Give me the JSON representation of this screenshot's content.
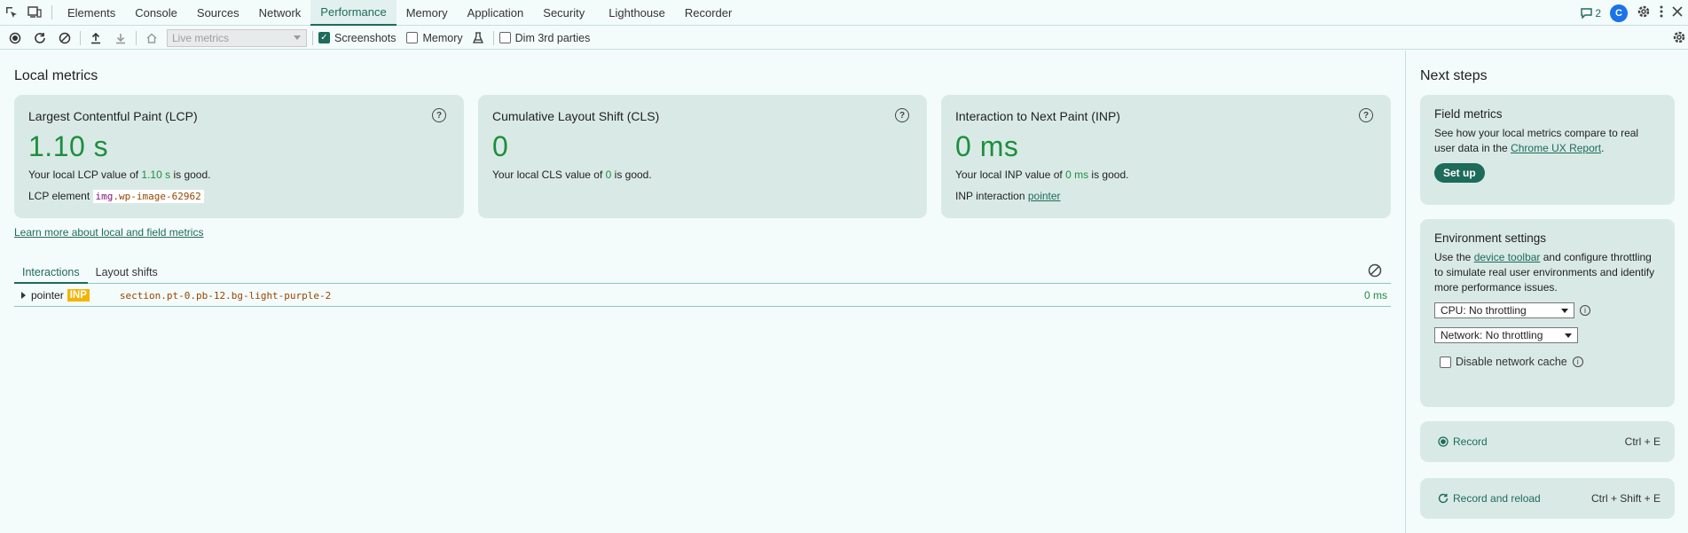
{
  "tabs": [
    "Elements",
    "Console",
    "Sources",
    "Network",
    "Performance",
    "Memory",
    "Application",
    "Security",
    "Lighthouse",
    "Recorder"
  ],
  "active_tab": "Performance",
  "issues_count": "2",
  "toolbar": {
    "select_value": "Live metrics",
    "screenshots_label": "Screenshots",
    "memory_label": "Memory",
    "dim_label": "Dim 3rd parties"
  },
  "local": {
    "title": "Local metrics",
    "lcp": {
      "title": "Largest Contentful Paint (LCP)",
      "value": "1.10 s",
      "desc_prefix": "Your local LCP value of ",
      "desc_value": "1.10 s",
      "desc_suffix": " is good.",
      "detail_label": "LCP element",
      "detail_tag": "img",
      "detail_class": ".wp-image-62962"
    },
    "cls": {
      "title": "Cumulative Layout Shift (CLS)",
      "value": "0",
      "desc_prefix": "Your local CLS value of ",
      "desc_value": "0",
      "desc_suffix": " is good."
    },
    "inp": {
      "title": "Interaction to Next Paint (INP)",
      "value": "0 ms",
      "desc_prefix": "Your local INP value of ",
      "desc_value": "0 ms",
      "desc_suffix": " is good.",
      "detail_label": "INP interaction",
      "detail_link": "pointer"
    },
    "learn_link": "Learn more about local and field metrics",
    "subtabs": [
      "Interactions",
      "Layout shifts"
    ],
    "row": {
      "type": "pointer",
      "badge": "INP",
      "selector": "section.pt-0.pb-12.bg-light-purple-2",
      "duration": "0 ms"
    }
  },
  "next": {
    "title": "Next steps",
    "field": {
      "title": "Field metrics",
      "text_prefix": "See how your local metrics compare to real user data in the ",
      "link": "Chrome UX Report",
      "text_suffix": ".",
      "button": "Set up"
    },
    "env": {
      "title": "Environment settings",
      "text_prefix": "Use the ",
      "link": "device toolbar",
      "text_suffix": " and configure throttling to simulate real user environments and identify more performance issues.",
      "cpu": "CPU: No throttling",
      "network": "Network: No throttling",
      "cache_label": "Disable network cache"
    },
    "record": {
      "label": "Record",
      "shortcut": "Ctrl + E"
    },
    "reload": {
      "label": "Record and reload",
      "shortcut": "Ctrl + Shift + E"
    }
  },
  "colors": {
    "accent": "#1e6b5b",
    "good": "#1e8e3e",
    "card": "#d9eae6",
    "badge": "#f5b400"
  }
}
